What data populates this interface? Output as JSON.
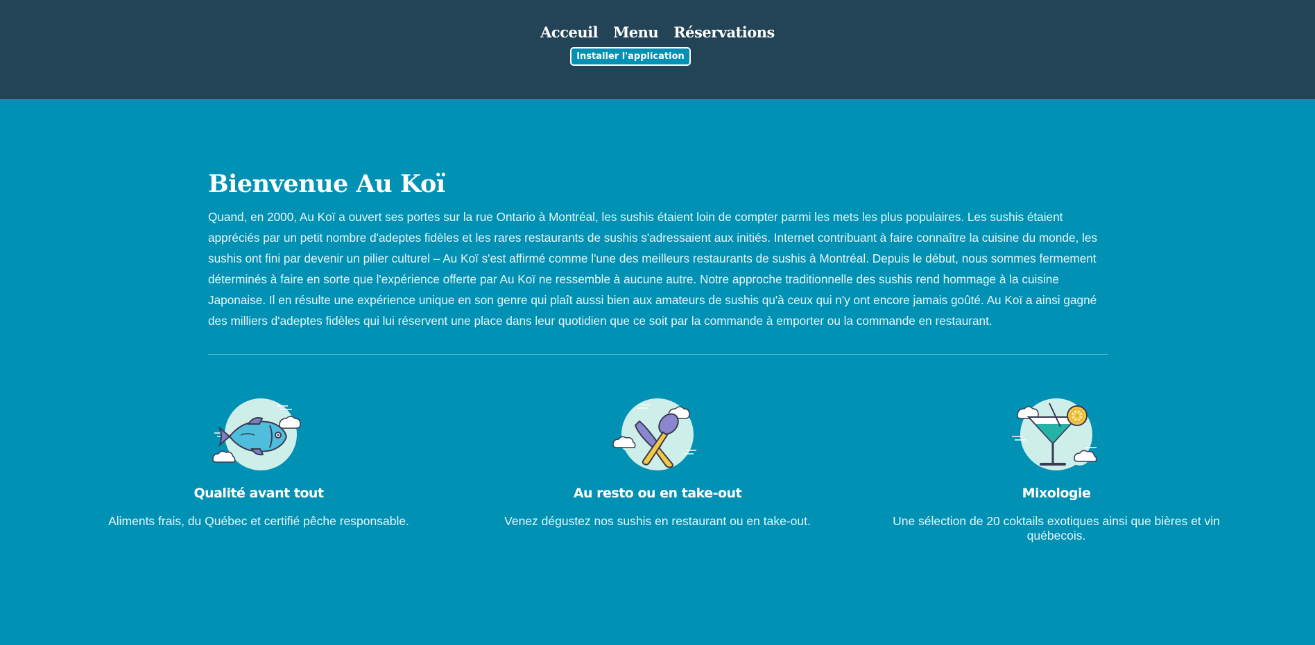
{
  "nav": {
    "items": [
      {
        "label": "Acceuil"
      },
      {
        "label": "Menu"
      },
      {
        "label": "Réservations"
      }
    ],
    "install_label": "Installer l'application"
  },
  "welcome": {
    "title": "Bienvenue Au Koï",
    "body": "Quand, en 2000, Au Koï a ouvert ses portes sur la rue Ontario à Montréal, les sushis étaient loin de compter parmi les mets les plus populaires. Les sushis étaient appréciés par un petit nombre d'adeptes fidèles et les rares restaurants de sushis s'adressaient aux initiés. Internet contribuant à faire connaître la cuisine du monde, les sushis ont fini par devenir un pilier culturel – Au Koï s'est affirmé comme l'une des meilleurs restaurants de sushis à Montréal. Depuis le début, nous sommes fermement déterminés à faire en sorte que l'expérience offerte par Au Koï ne ressemble à aucune autre. Notre approche traditionnelle des sushis rend hommage à la cuisine Japonaise. Il en résulte une expérience unique en son genre qui plaît aussi bien aux amateurs de sushis qu'à ceux qui n'y ont encore jamais goûté. Au Koï a ainsi gagné des milliers d'adeptes fidèles qui lui réservent une place dans leur quotidien que ce soit par la commande à emporter ou la commande en restaurant."
  },
  "features": [
    {
      "icon": "fish-icon",
      "title": "Qualité avant tout",
      "desc": "Aliments frais, du Québec et certifié pêche responsable."
    },
    {
      "icon": "utensils-icon",
      "title": "Au resto ou en take-out",
      "desc": "Venez dégustez nos sushis en restaurant ou en take-out."
    },
    {
      "icon": "cocktail-icon",
      "title": "Mixologie",
      "desc": "Une sélection de 20 coktails exotiques ainsi que bières et vin québecois."
    }
  ],
  "colors": {
    "header_bg": "#234357",
    "page_bg": "#0091b5",
    "icon_blob": "#cdeee9"
  }
}
